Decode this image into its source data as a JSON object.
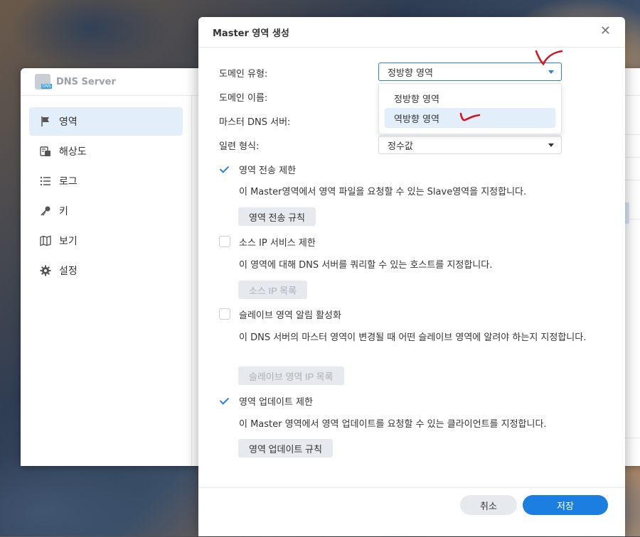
{
  "app": {
    "title": "DNS Server"
  },
  "sidebar": {
    "items": [
      {
        "label": "영역",
        "icon": "flag-icon",
        "active": true
      },
      {
        "label": "해상도",
        "icon": "resolution-icon",
        "active": false
      },
      {
        "label": "로그",
        "icon": "list-icon",
        "active": false
      },
      {
        "label": "키",
        "icon": "key-icon",
        "active": false
      },
      {
        "label": "보기",
        "icon": "map-icon",
        "active": false
      },
      {
        "label": "설정",
        "icon": "gear-icon",
        "active": false
      }
    ]
  },
  "dialog": {
    "title": "Master 영역 생성",
    "fields": {
      "domain_type": {
        "label": "도메인 유형:",
        "value": "정방향 영역",
        "options": [
          "정방향 영역",
          "역방향 영역"
        ]
      },
      "domain_name": {
        "label": "도메인 이름:"
      },
      "master_dns": {
        "label": "마스터 DNS 서버:"
      },
      "serial_format": {
        "label": "일련 형식:",
        "value": "정수값"
      }
    },
    "options": {
      "zone_transfer": {
        "label": "영역 전송 제한",
        "checked": true,
        "desc": "이 Master영역에서 영역 파일을 요청할 수 있는 Slave영역을 지정합니다.",
        "button": "영역 전송 규칙"
      },
      "source_ip": {
        "label": "소스 IP 서비스 제한",
        "checked": false,
        "desc": "이 영역에 대해 DNS 서버를 쿼리할 수 있는 호스트를 지정합니다.",
        "button": "소스 IP 목록"
      },
      "slave_notify": {
        "label": "슬레이브 영역 알림 활성화",
        "checked": false,
        "desc": "이 DNS 서버의 마스터 영역이 변경될 때 어떤 슬레이브 영역에 알려야 하는지 지정합니다.",
        "button": "슬레이브 영역 IP 목록"
      },
      "zone_update": {
        "label": "영역 업데이트 제한",
        "checked": true,
        "desc": "이 Master 영역에서 영역 업데이트를 요청할 수 있는 클라이언트를 지정합니다.",
        "button": "영역 업데이트 규칙"
      }
    },
    "footer": {
      "cancel": "취소",
      "save": "저장"
    }
  },
  "colors": {
    "accent": "#1a7fe0",
    "annotation": "#d8121e"
  }
}
